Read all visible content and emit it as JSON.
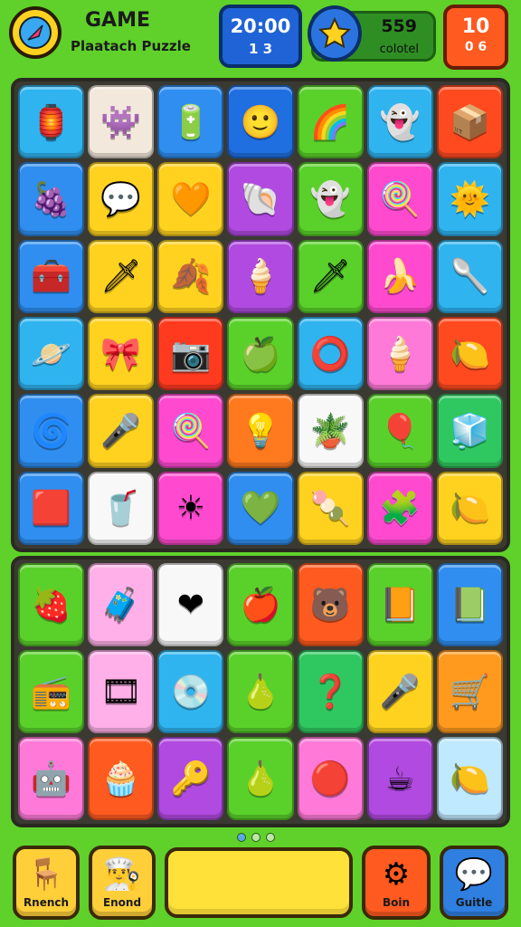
{
  "header": {
    "title": "GAME",
    "subtitle": "Plaatach Puzzle",
    "timer": "20:00",
    "timer_sub": "1   3",
    "score": "559",
    "score_label": "colotel",
    "level": "10",
    "level_sub": "0 6",
    "logo_icon": "compass-icon",
    "star_icon": "star-icon"
  },
  "board_top": [
    {
      "icon": "lantern-icon",
      "glyph": "🏮",
      "color": "#2fb4f0"
    },
    {
      "icon": "creature-icon",
      "glyph": "👾",
      "color": "#f3e8dc"
    },
    {
      "icon": "battery-icon",
      "glyph": "🔋",
      "color": "#2f8ef0"
    },
    {
      "icon": "face-icon",
      "glyph": "🙂",
      "color": "#1f6fe0"
    },
    {
      "icon": "rainbow-icon",
      "glyph": "🌈",
      "color": "#5ad12a"
    },
    {
      "icon": "ghost-icon",
      "glyph": "👻",
      "color": "#2fb4f0"
    },
    {
      "icon": "box-icon",
      "glyph": "📦",
      "color": "#ff4a1f"
    },
    {
      "icon": "plum-icon",
      "glyph": "🍇",
      "color": "#2f8ef0"
    },
    {
      "icon": "speech-bubble-icon",
      "glyph": "💬",
      "color": "#ffd21f"
    },
    {
      "icon": "heart-bubble-icon",
      "glyph": "🧡",
      "color": "#ffd21f"
    },
    {
      "icon": "seashell-icon",
      "glyph": "🐚",
      "color": "#b04ae0"
    },
    {
      "icon": "ghost-icon",
      "glyph": "👻",
      "color": "#5ad12a"
    },
    {
      "icon": "lollipop-icon",
      "glyph": "🍭",
      "color": "#ff4ad0"
    },
    {
      "icon": "sun-face-icon",
      "glyph": "🌞",
      "color": "#2fb4f0"
    },
    {
      "icon": "treasure-chest-icon",
      "glyph": "🧰",
      "color": "#2f8ef0"
    },
    {
      "icon": "dagger-icon",
      "glyph": "🗡",
      "color": "#ffd21f"
    },
    {
      "icon": "leaf-icon",
      "glyph": "🍂",
      "color": "#ffd21f"
    },
    {
      "icon": "ice-cream-icon",
      "glyph": "🍦",
      "color": "#b04ae0"
    },
    {
      "icon": "dagger-icon",
      "glyph": "🗡",
      "color": "#5ad12a"
    },
    {
      "icon": "banana-icon",
      "glyph": "🍌",
      "color": "#ff4ad0"
    },
    {
      "icon": "shovel-icon",
      "glyph": "🥄",
      "color": "#2fb4f0"
    },
    {
      "icon": "planet-icon",
      "glyph": "🪐",
      "color": "#2fb4f0"
    },
    {
      "icon": "ribbon-icon",
      "glyph": "🎀",
      "color": "#ffd21f"
    },
    {
      "icon": "camera-icon",
      "glyph": "📷",
      "color": "#ff3a1f"
    },
    {
      "icon": "apple-icon",
      "glyph": "🍏",
      "color": "#5ad12a"
    },
    {
      "icon": "ring-icon",
      "glyph": "⭕",
      "color": "#2fb4f0"
    },
    {
      "icon": "ice-cream-icon",
      "glyph": "🍦",
      "color": "#ff7ad8"
    },
    {
      "icon": "lemon-icon",
      "glyph": "🍋",
      "color": "#ff4a1f"
    },
    {
      "icon": "swirl-icon",
      "glyph": "🌀",
      "color": "#2f8ef0"
    },
    {
      "icon": "microphone-icon",
      "glyph": "🎤",
      "color": "#ffd21f"
    },
    {
      "icon": "lollipop-icon",
      "glyph": "🍭",
      "color": "#ff4ad0"
    },
    {
      "icon": "bulb-icon",
      "glyph": "💡",
      "color": "#ff7a1f"
    },
    {
      "icon": "potted-plant-icon",
      "glyph": "🪴",
      "color": "#f8f8f8"
    },
    {
      "icon": "balloon-icon",
      "glyph": "🎈",
      "color": "#5ad12a"
    },
    {
      "icon": "cube-icon",
      "glyph": "🧊",
      "color": "#2fc860"
    },
    {
      "icon": "card-icon",
      "glyph": "🟥",
      "color": "#2f8ef0"
    },
    {
      "icon": "cup-icon",
      "glyph": "🥤",
      "color": "#f8f8f8"
    },
    {
      "icon": "sun-icon",
      "glyph": "☀",
      "color": "#ff4ad0"
    },
    {
      "icon": "gem-icon",
      "glyph": "💚",
      "color": "#2f8ef0"
    },
    {
      "icon": "popsicle-icon",
      "glyph": "🍡",
      "color": "#ffd21f"
    },
    {
      "icon": "blob-icon",
      "glyph": "🧩",
      "color": "#ff4ad0"
    },
    {
      "icon": "lemon-icon",
      "glyph": "🍋",
      "color": "#ffd21f"
    }
  ],
  "board_bottom": [
    {
      "icon": "berry-icon",
      "glyph": "🍓",
      "color": "#5ad12a"
    },
    {
      "icon": "chest-icon",
      "glyph": "🧳",
      "color": "#ffb0e8"
    },
    {
      "icon": "gem-red-icon",
      "glyph": "❤",
      "color": "#f8f8f8"
    },
    {
      "icon": "apple-icon",
      "glyph": "🍎",
      "color": "#5ad12a"
    },
    {
      "icon": "critter-icon",
      "glyph": "🐻",
      "color": "#ff5a1f"
    },
    {
      "icon": "note-icon",
      "glyph": "📙",
      "color": "#5ad12a"
    },
    {
      "icon": "book-icon",
      "glyph": "📗",
      "color": "#2f8ef0"
    },
    {
      "icon": "radio-icon",
      "glyph": "📻",
      "color": "#5ad12a"
    },
    {
      "icon": "film-icon",
      "glyph": "🎞",
      "color": "#ffb0e8"
    },
    {
      "icon": "disc-icon",
      "glyph": "💿",
      "color": "#2fb4f0"
    },
    {
      "icon": "fruit-face-icon",
      "glyph": "🍐",
      "color": "#5ad12a"
    },
    {
      "icon": "hook-icon",
      "glyph": "❓",
      "color": "#2fc860"
    },
    {
      "icon": "microphone-icon",
      "glyph": "🎤",
      "color": "#ffd21f"
    },
    {
      "icon": "cart-icon",
      "glyph": "🛒",
      "color": "#ff9a1f"
    },
    {
      "icon": "robot-icon",
      "glyph": "🤖",
      "color": "#ff7ad8"
    },
    {
      "icon": "cupcake-icon",
      "glyph": "🧁",
      "color": "#ff5a1f"
    },
    {
      "icon": "ring-key-icon",
      "glyph": "🔑",
      "color": "#b04ae0"
    },
    {
      "icon": "pear-icon",
      "glyph": "🍐",
      "color": "#5ad12a"
    },
    {
      "icon": "ball-icon",
      "glyph": "🔴",
      "color": "#ff7ad8"
    },
    {
      "icon": "mug-icon",
      "glyph": "☕",
      "color": "#b04ae0"
    },
    {
      "icon": "lemon-icon",
      "glyph": "🍋",
      "color": "#bfe9ff"
    }
  ],
  "footer": {
    "btn1_label": "Rnench",
    "btn1_icon": "chair-icon",
    "btn2_label": "Enond",
    "btn2_icon": "chef-hat-icon",
    "btn3_label": "Boin",
    "btn3_icon": "gear-icon",
    "btn4_label": "Guitle",
    "btn4_icon": "chat-icon"
  }
}
